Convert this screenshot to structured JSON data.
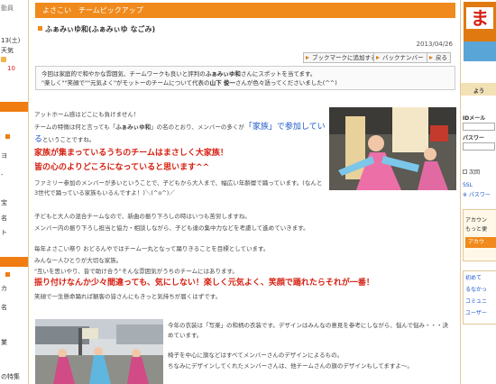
{
  "left_sidebar": {
    "item0": "動員",
    "item1": "13(土)",
    "item2": "天気",
    "item3": "10",
    "item4": "ヨ",
    "item5": "-",
    "item6": "宝",
    "item7": "名",
    "item8": "ト",
    "item9": "カ",
    "item10": "名",
    "item11": "業",
    "item12": "の特集"
  },
  "banner": {
    "title": "よさこい　チームピックアップ"
  },
  "article": {
    "team_title": "ふぁみぃゆ和(ふぁみぃゆ なごみ)",
    "date": "2013/04/26",
    "buttons": {
      "bookmark": "ブックマークに追加する",
      "back_number": "バックナンバー",
      "back": "戻る"
    },
    "intro_line1_a": "今回は家庭的で和やかな雰囲気、チームワークも良いと評判の",
    "intro_line1_b": "ふぁみぃゆ和",
    "intro_line1_c": "さんにスポットを当てます。",
    "intro_line2_a": "\"楽しく\"\"笑顔で\"\"元気よく\"がモットーのチームについて代表の",
    "intro_line2_b": "山下 俊一",
    "intro_line2_c": "さんが色々語ってくださいました(^^)",
    "p1": "アットホーム感はどこにも負けません！",
    "p2_a": "チームの特徴は何と言っても「",
    "p2_b": "ふぁみぃゆ和",
    "p2_c": "」の名のとおり、メンバーの多くが",
    "p2_d": "「家族」で参加してい",
    "p3_a": "る",
    "p3_b": "ということですね。",
    "p4": "家族が集まっているうちのチームはまさしく大家族！",
    "p5": "皆の心のよりどころになっていると思います^^",
    "p6": "ファミリー参加のメンバーが多いということで、子どもから大人まで、幅広い年齢層で踊っています。(なんと",
    "p7": "3世代で踊っている家族もいるんですよ！)＼(^o^)／",
    "p8": "子どもと大人の混合チームなので、新曲の振り下ろしの時はいつも苦労しますね。",
    "p9": "メンバー内の振り下ろし担当と協力・相談しながら、子ども達の集中力などを考慮して進めていきます。",
    "p10": "毎年よさこい祭り おどるんやではチーム一丸となって踊りきることを目標としています。",
    "p11": "みんな一人ひとりが大切な家族。",
    "p12": "\"互いを思いやり、皆で助け合う\"そんな雰囲気がうちのチームにはあります。",
    "p13": "振り付けなんか少々間違っても、気にしない！楽しく元気よく、笑顔で踊れたらそれが一番！",
    "p14": "笑顔で一生懸命踊れば観客の皆さんにもきっと気持ちが届くはずです。",
    "p15": "今年の衣装は「写楽」の和柄の衣装です。デザインはみんなの意見を参考にしながら、悩んで悩み・・・決",
    "p16": "めています。",
    "p17": "椅子を中心に旗などはすべてメンバーさんのデザインによるもの。",
    "p18": "ちなみにデザインしてくれたメンバーさんは、他チームさんの旗のデザインもしてますよ～。"
  },
  "right_sidebar": {
    "logo_char": "ま",
    "you": "よう",
    "id_label": "IDメール",
    "pw_label": "パスワー",
    "auto": "次回",
    "ssl": "SSL",
    "pass": "※ パスワー",
    "account1": "アカウン",
    "account2": "もっと便",
    "account_btn": "アカウ",
    "link1": "初めて",
    "link2": "るなかっ",
    "link3": "コミュニ",
    "link4": "ユーザー"
  },
  "colors": {
    "accent": "#f08a1c",
    "red_text": "#d61e10",
    "blue_text": "#1a56c9"
  }
}
